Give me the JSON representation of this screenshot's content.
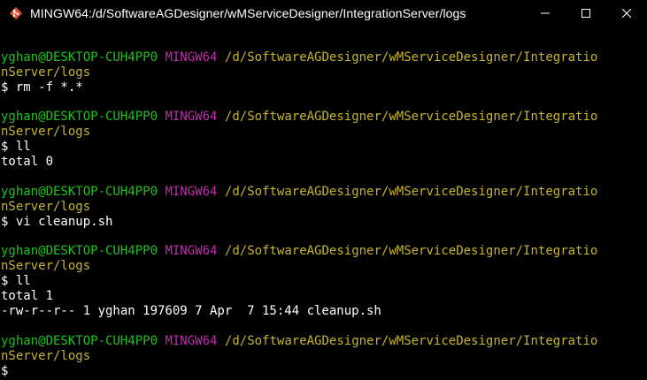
{
  "window": {
    "title": "MINGW64:/d/SoftwareAGDesigner/wMServiceDesigner/IntegrationServer/logs",
    "controls": [
      "minimize",
      "maximize",
      "close"
    ],
    "colors": {
      "background": "#000000",
      "user": "#1CC21C",
      "host": "#C02CB0",
      "path": "#C7B42B",
      "text": "#FFFFFF"
    }
  },
  "prompt": {
    "user_host": "yghan@DESKTOP-CUH4PP0",
    "shell": "MINGW64",
    "path_part1": "/d/SoftwareAGDesigner/wMServiceDesigner/Integratio",
    "path_part2": "nServer/logs",
    "symbol": "$"
  },
  "commands": {
    "c1": "$ rm -f *.*",
    "c2": "$ ll",
    "c3": "$ vi cleanup.sh",
    "c4": "$ ll",
    "c5": "$"
  },
  "outputs": {
    "o2": "total 0",
    "o4a": "total 1",
    "o4b": "-rw-r--r-- 1 yghan 197609 7 Apr  7 15:44 cleanup.sh"
  }
}
